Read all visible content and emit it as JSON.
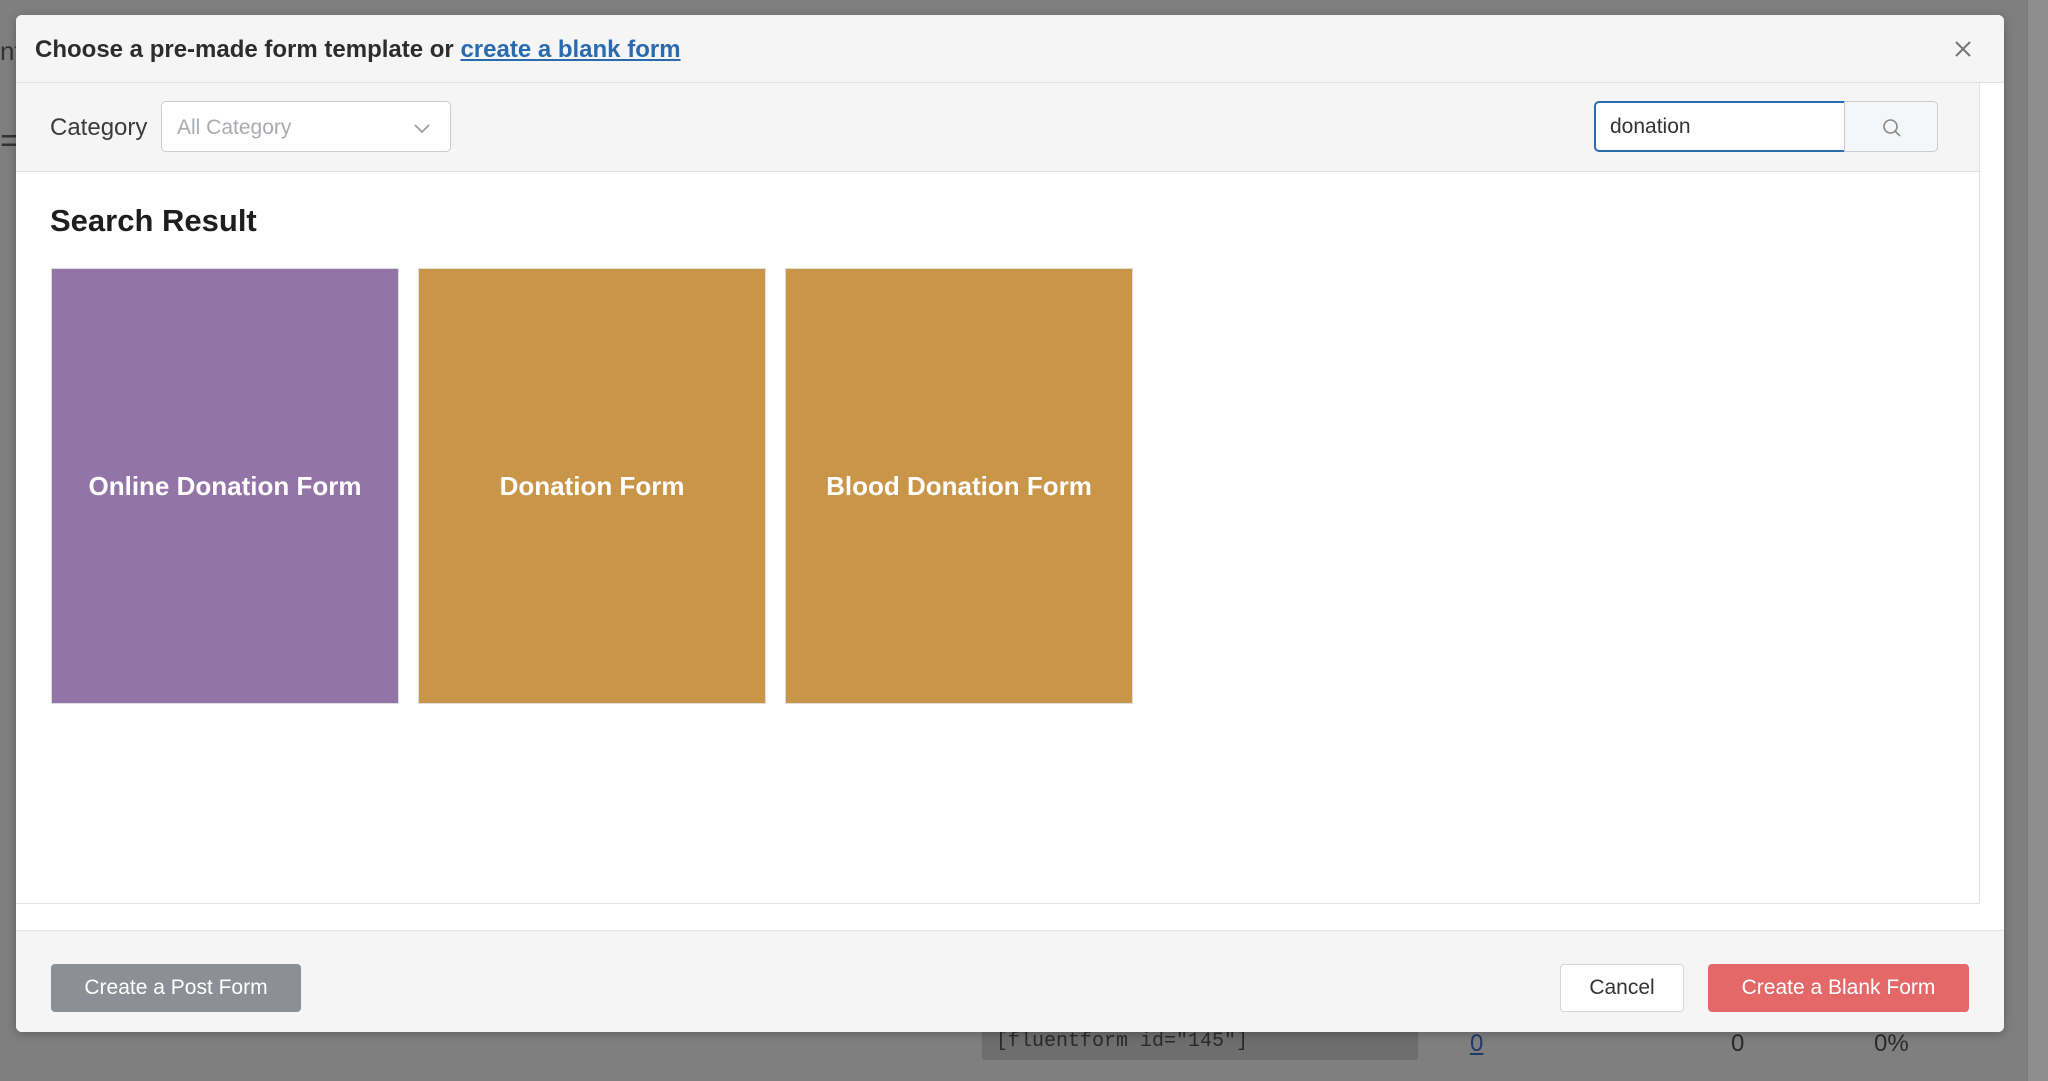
{
  "background": {
    "edge_text_top": "nt",
    "edge_text_mid": "=",
    "shortcode": "[fluentform id=\"145\"]",
    "row_cells": [
      "0",
      "0",
      "0%"
    ]
  },
  "modal": {
    "title_prefix": "Choose a pre-made form template or ",
    "title_link": "create a blank form",
    "close_icon": "close-icon"
  },
  "filter": {
    "category_label": "Category",
    "category_value": "All Category",
    "search_value": "donation",
    "search_icon": "search-icon"
  },
  "results": {
    "heading": "Search Result",
    "cards": [
      {
        "label": "Online Donation Form",
        "color": "#9275a6"
      },
      {
        "label": "Donation Form",
        "color": "#c99548"
      },
      {
        "label": "Blood Donation Form",
        "color": "#c99548"
      }
    ]
  },
  "footer": {
    "post_form_label": "Create a Post Form",
    "cancel_label": "Cancel",
    "blank_form_label": "Create a Blank Form"
  }
}
